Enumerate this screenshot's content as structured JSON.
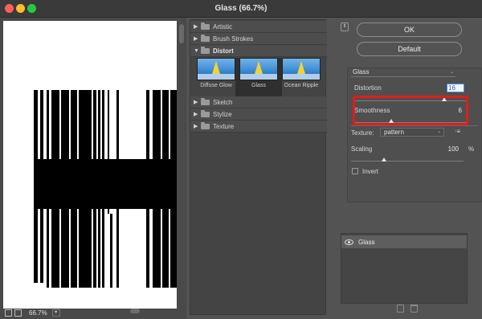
{
  "window": {
    "title": "Glass (66.7%)"
  },
  "preview": {
    "zoom": "66.7%",
    "zoom_dropdown_icon": "chevron-down-icon"
  },
  "gallery": {
    "categories": [
      {
        "label": "Artistic",
        "expanded": false
      },
      {
        "label": "Brush Strokes",
        "expanded": false
      },
      {
        "label": "Distort",
        "expanded": true
      },
      {
        "label": "Sketch",
        "expanded": false
      },
      {
        "label": "Stylize",
        "expanded": false
      },
      {
        "label": "Texture",
        "expanded": false
      }
    ],
    "thumbnails": [
      {
        "label": "Diffuse Glow",
        "selected": false
      },
      {
        "label": "Glass",
        "selected": true
      },
      {
        "label": "Ocean Ripple",
        "selected": false
      }
    ]
  },
  "buttons": {
    "ok": "OK",
    "default": "Default"
  },
  "settings": {
    "filter_name": "Glass",
    "distortion_label": "Distortion",
    "distortion_value": "16",
    "distortion_level": 0.8,
    "smoothness_label": "Smoothness",
    "smoothness_value": "6",
    "smoothness_level": 0.33,
    "texture_label": "Texture:",
    "texture_value": "pattern",
    "scaling_label": "Scaling",
    "scaling_value": "100",
    "scaling_unit": "%",
    "scaling_level": 0.29,
    "invert_label": "Invert",
    "invert_checked": false
  },
  "layers": {
    "items": [
      {
        "label": "Glass",
        "visible": true
      }
    ]
  },
  "colors": {
    "background": "#535353",
    "highlight": "#e21b1b",
    "value_focus": "#3c8df1"
  }
}
